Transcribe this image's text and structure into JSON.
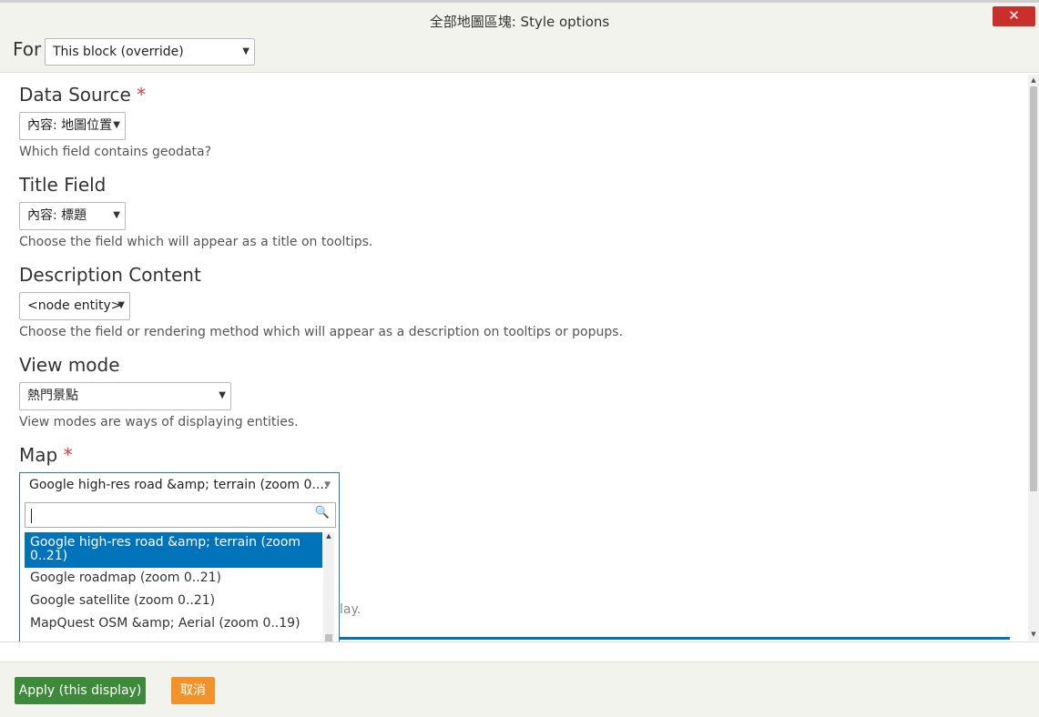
{
  "dialog": {
    "title": "全部地圖區塊: Style options",
    "close_icon": "close-icon",
    "close_glyph": "✕"
  },
  "for_row": {
    "label": "For",
    "select_value": "This block (override)"
  },
  "fields": {
    "data_source": {
      "label": "Data Source",
      "required_mark": "*",
      "value": "內容: 地圖位置",
      "description": "Which field contains geodata?"
    },
    "title_field": {
      "label": "Title Field",
      "value": "內容: 標題",
      "description": "Choose the field which will appear as a title on tooltips."
    },
    "description_content": {
      "label": "Description Content",
      "value": "<node entity>",
      "description": "Choose the field or rendering method which will appear as a description on tooltips or popups."
    },
    "view_mode": {
      "label": "View mode",
      "value": "熱門景點",
      "description": "View modes are ways of displaying entities."
    },
    "map": {
      "label": "Map",
      "required_mark": "*",
      "value": "Google high-res road &amp; terrain (zoom 0....",
      "options": [
        "Google high-res road &amp; terrain (zoom 0..21)",
        "Google roadmap (zoom 0..21)",
        "Google satellite (zoom 0..21)",
        "MapQuest OSM &amp; Aerial (zoom 0..19)"
      ],
      "selected_index": 0,
      "partial_description": "lay."
    }
  },
  "footer": {
    "apply_label": "Apply (this display)",
    "cancel_label": "取消"
  },
  "colors": {
    "close_red": "#c9302c",
    "apply_green": "#3f8a3a",
    "cancel_orange": "#f0932b",
    "selected_blue": "#0073bb",
    "required_red": "#e03a3a"
  },
  "icons": {
    "caret": "chevron-down-icon",
    "search": "search-icon",
    "caret_glyph": "▼",
    "search_glyph": "🔍",
    "scroll_up_glyph": "▲",
    "scroll_down_glyph": "▼"
  }
}
